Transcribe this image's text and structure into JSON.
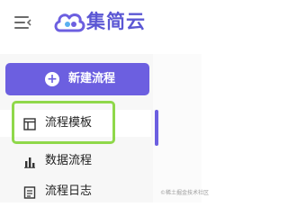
{
  "app": {
    "brand": "集简云"
  },
  "menu": {
    "icon": "hamburger-menu-icon"
  },
  "new_flow": {
    "label": "新建流程",
    "icon": "plus-circle-icon"
  },
  "nav": {
    "items": [
      {
        "label": "流程模板",
        "icon": "template-icon",
        "active": true
      },
      {
        "label": "数据流程",
        "icon": "bar-chart-icon"
      },
      {
        "label": "流程日志",
        "icon": "log-icon"
      }
    ]
  },
  "colors": {
    "accent": "#6c5fe0",
    "highlight": "#8fd84a"
  },
  "watermark": "©稀土掘金技术社区"
}
